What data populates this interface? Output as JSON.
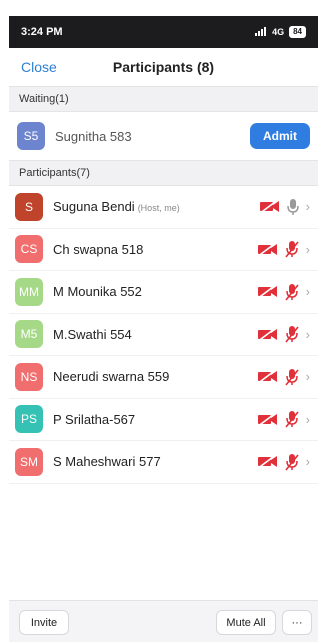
{
  "status_bar": {
    "time": "3:24 PM",
    "network": "4G",
    "battery": "84"
  },
  "header": {
    "close_label": "Close",
    "title": "Participants (8)"
  },
  "waiting": {
    "header": "Waiting(1)",
    "user": {
      "initials": "S5",
      "name": "Sugnitha 583",
      "avatar_color": "#6d84cf"
    },
    "admit_label": "Admit"
  },
  "participants": {
    "header": "Participants(7)",
    "items": [
      {
        "initials": "S",
        "name": "Suguna Bendi",
        "tag": "(Host, me)",
        "avatar_color": "#c0432b",
        "mic": "gray-mic-icon"
      },
      {
        "initials": "CS",
        "name": "Ch swapna 518",
        "avatar_color": "#f06e6e",
        "mic": "muted-mic-icon"
      },
      {
        "initials": "MM",
        "name": "M Mounika 552",
        "avatar_color": "#a5d988",
        "mic": "muted-mic-icon"
      },
      {
        "initials": "M5",
        "name": "M.Swathi 554",
        "avatar_color": "#a5d988",
        "mic": "muted-mic-icon"
      },
      {
        "initials": "NS",
        "name": "Neerudi swarna 559",
        "avatar_color": "#f06e6e",
        "mic": "muted-mic-icon"
      },
      {
        "initials": "PS",
        "name": "P Srilatha-567",
        "avatar_color": "#35c2b4",
        "mic": "muted-mic-icon"
      },
      {
        "initials": "SM",
        "name": "S Maheshwari 577",
        "avatar_color": "#f06e6e",
        "mic": "muted-mic-icon"
      }
    ]
  },
  "footer": {
    "invite_label": "Invite",
    "mute_all_label": "Mute All",
    "more_label": "···"
  },
  "colors": {
    "accent": "#2f7de1",
    "muted_red": "#e0303a"
  }
}
